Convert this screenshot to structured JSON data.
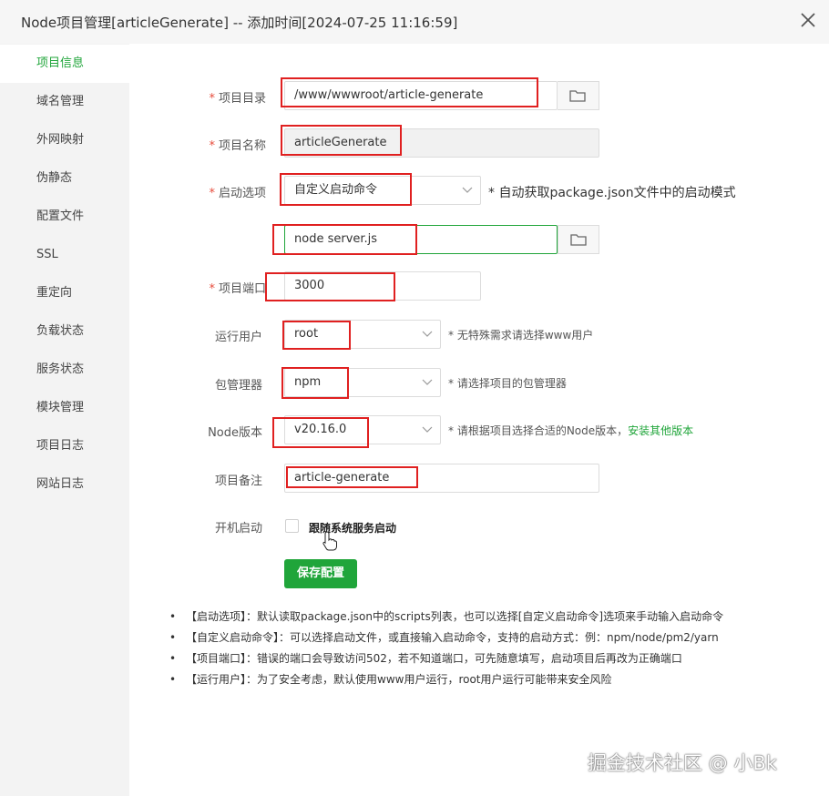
{
  "dialog": {
    "title": "Node项目管理[articleGenerate] -- 添加时间[2024-07-25 11:16:59]"
  },
  "sidebar": {
    "items": [
      {
        "label": "项目信息",
        "active": true
      },
      {
        "label": "域名管理"
      },
      {
        "label": "外网映射"
      },
      {
        "label": "伪静态"
      },
      {
        "label": "配置文件"
      },
      {
        "label": "SSL"
      },
      {
        "label": "重定向"
      },
      {
        "label": "负载状态"
      },
      {
        "label": "服务状态"
      },
      {
        "label": "模块管理"
      },
      {
        "label": "项目日志"
      },
      {
        "label": "网站日志"
      }
    ]
  },
  "form": {
    "required_mark": "*",
    "project_dir": {
      "label": "项目目录",
      "value": "/www/wwwroot/article-generate"
    },
    "project_name": {
      "label": "项目名称",
      "value": "articleGenerate"
    },
    "start_option": {
      "label": "启动选项",
      "value": "自定义启动命令",
      "hint": "* 自动获取package.json文件中的启动模式"
    },
    "start_command": {
      "value": "node server.js"
    },
    "project_port": {
      "label": "项目端口",
      "value": "3000"
    },
    "run_user": {
      "label": "运行用户",
      "value": "root",
      "hint": "* 无特殊需求请选择www用户"
    },
    "package_manager": {
      "label": "包管理器",
      "value": "npm",
      "hint": "* 请选择项目的包管理器"
    },
    "node_version": {
      "label": "Node版本",
      "value": "v20.16.0",
      "hint": "* 请根据项目选择合适的Node版本，",
      "hint_link": "安装其他版本"
    },
    "project_note": {
      "label": "项目备注",
      "value": "article-generate"
    },
    "autostart": {
      "label": "开机启动",
      "checkbox_label": "跟随系统服务启动",
      "checked": false
    },
    "save_button": "保存配置"
  },
  "notes": [
    "【启动选项】：默认读取package.json中的scripts列表，也可以选择[自定义启动命令]选项来手动输入启动命令",
    "【自定义启动命令】：可以选择启动文件，或直接输入启动命令，支持的启动方式：例：npm/node/pm2/yarn",
    "【项目端口】：错误的端口会导致访问502，若不知道端口，可先随意填写，启动项目后再改为正确端口",
    "【运行用户】：为了安全考虑，默认使用www用户运行，root用户运行可能带来安全风险"
  ],
  "watermark": "掘金技术社区 @ 小Bk",
  "colors": {
    "accent": "#20a53a",
    "highlight_box": "#e02020",
    "required": "#e74c3c"
  },
  "icons": [
    "close-icon",
    "folder-icon",
    "chevron-down-icon",
    "hand-cursor-icon"
  ]
}
